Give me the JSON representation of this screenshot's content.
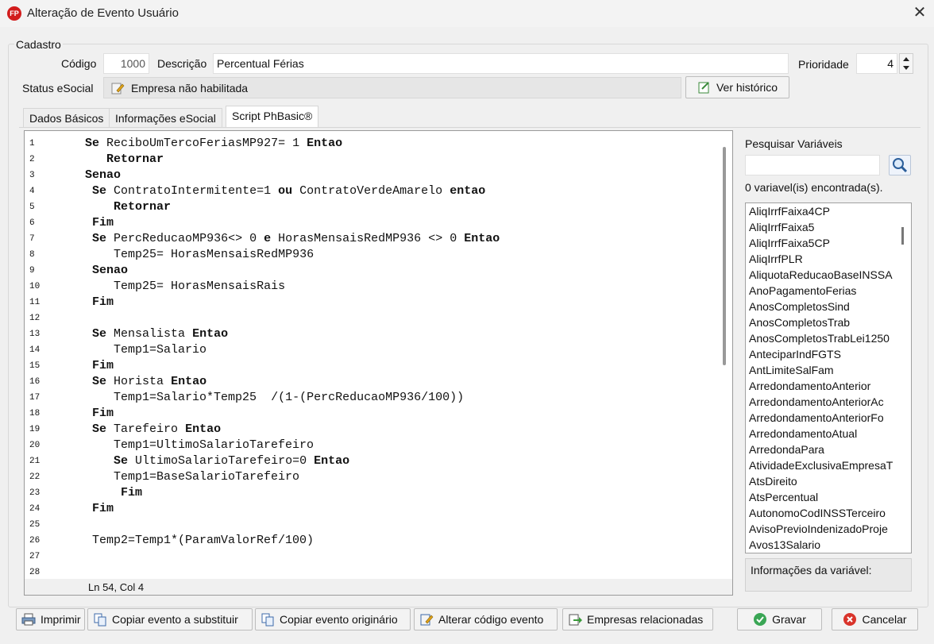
{
  "window": {
    "title": "Alteração de Evento Usuário",
    "app_icon_text": "FP",
    "close_symbol": "✕"
  },
  "cadastro": {
    "legend": "Cadastro",
    "codigo_label": "Código",
    "codigo_value": "1000",
    "descricao_label": "Descrição",
    "descricao_value": "Percentual Férias",
    "prioridade_label": "Prioridade",
    "prioridade_value": "4",
    "status_label": "Status eSocial",
    "status_value": "Empresa não habilitada",
    "historico_button": "Ver histórico"
  },
  "tabs": [
    {
      "label": "Dados Básicos"
    },
    {
      "label": "Informações eSocial"
    },
    {
      "label": "Script PhBasic®"
    }
  ],
  "editor": {
    "status": "Ln 54, Col 4",
    "line_numbers": [
      "1",
      "2",
      "3",
      "4",
      "5",
      "6",
      "7",
      "8",
      "9",
      "10",
      "11",
      "12",
      "13",
      "14",
      "15",
      "16",
      "17",
      "18",
      "19",
      "20",
      "21",
      "22",
      "23",
      "24",
      "25",
      "26",
      "27",
      "28"
    ],
    "lines": [
      "Se ReciboUmTercoFeriasMP927= 1 Entao",
      "   Retornar",
      "Senao",
      " Se ContratoIntermitente=1 ou ContratoVerdeAmarelo entao",
      "    Retornar",
      " Fim",
      " Se PercReducaoMP936<> 0 e HorasMensaisRedMP936 <> 0 Entao",
      "    Temp25= HorasMensaisRedMP936",
      " Senao",
      "    Temp25= HorasMensaisRais",
      " Fim",
      "",
      " Se Mensalista Entao",
      "    Temp1=Salario",
      " Fim",
      " Se Horista Entao",
      "    Temp1=Salario*Temp25  /(1-(PercReducaoMP936/100))",
      " Fim",
      " Se Tarefeiro Entao",
      "    Temp1=UltimoSalarioTarefeiro",
      "    Se UltimoSalarioTarefeiro=0 Entao",
      "    Temp1=BaseSalarioTarefeiro",
      "     Fim",
      " Fim",
      "",
      " Temp2=Temp1*(ParamValorRef/100)",
      "",
      ""
    ]
  },
  "variables": {
    "search_label": "Pesquisar Variáveis",
    "search_value": "",
    "found_text": "0 variavel(is) encontrada(s).",
    "items": [
      "AliqIrrfFaixa4CP",
      "AliqIrrfFaixa5",
      "AliqIrrfFaixa5CP",
      "AliqIrrfPLR",
      "AliquotaReducaoBaseINSSA",
      "AnoPagamentoFerias",
      "AnosCompletosSind",
      "AnosCompletosTrab",
      "AnosCompletosTrabLei1250",
      "AnteciparIndFGTS",
      "AntLimiteSalFam",
      "ArredondamentoAnterior",
      "ArredondamentoAnteriorAc",
      "ArredondamentoAnteriorFo",
      "ArredondamentoAtual",
      "ArredondaPara",
      "AtividadeExclusivaEmpresaT",
      "AtsDireito",
      "AtsPercentual",
      "AutonomoCodINSSTerceiro",
      "AvisoPrevioIndenizadoProje",
      "Avos13Salario"
    ],
    "info_label": "Informações da variável:"
  },
  "footer": {
    "imprimir": "Imprimir",
    "copiar_substituir": "Copiar evento a substituir",
    "copiar_originario": "Copiar evento originário",
    "alterar_codigo": "Alterar código evento",
    "empresas": "Empresas relacionadas",
    "gravar": "Gravar",
    "cancelar": "Cancelar"
  },
  "colors": {
    "accent_green": "#3aa655",
    "cancel_red": "#d9342b",
    "app_red": "#d21c1c"
  }
}
